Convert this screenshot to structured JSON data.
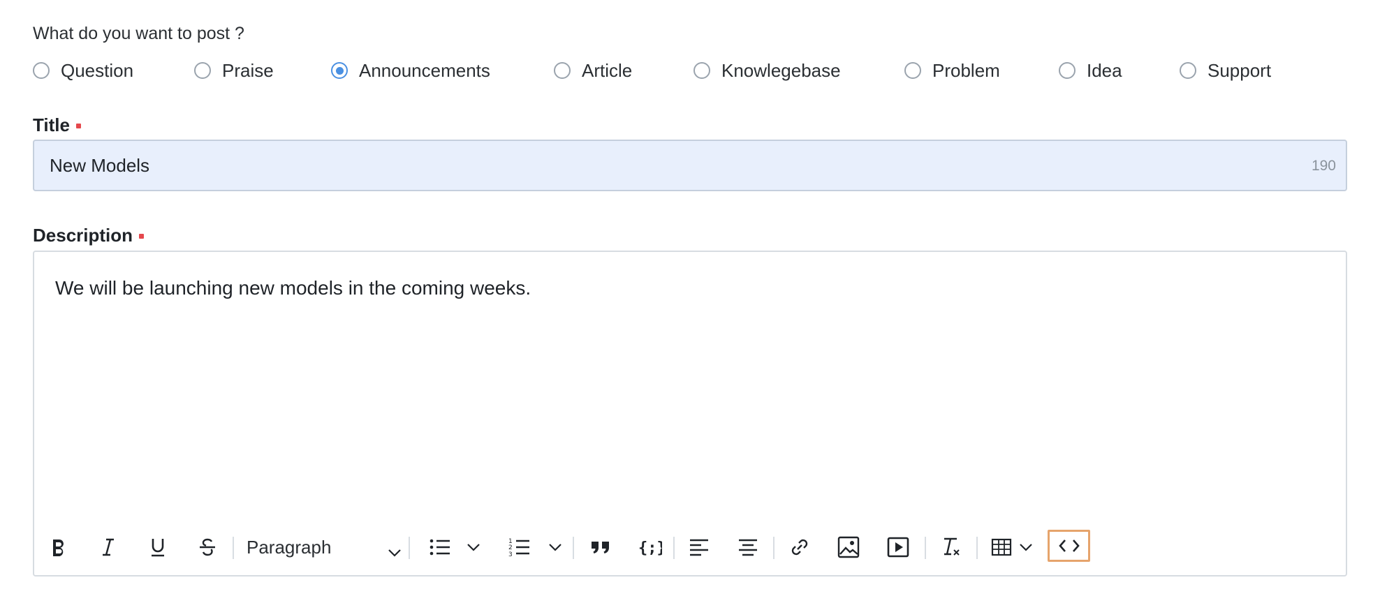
{
  "question": "What do you want to post ?",
  "post_types": [
    {
      "label": "Question",
      "checked": false
    },
    {
      "label": "Praise",
      "checked": false
    },
    {
      "label": "Announcements",
      "checked": true
    },
    {
      "label": "Article",
      "checked": false
    },
    {
      "label": "Knowlegebase",
      "checked": false
    },
    {
      "label": "Problem",
      "checked": false
    },
    {
      "label": "Idea",
      "checked": false
    },
    {
      "label": "Support",
      "checked": false
    }
  ],
  "title_field": {
    "label": "Title",
    "value": "New Models",
    "char_count": "190"
  },
  "description_field": {
    "label": "Description",
    "text": "We will be launching new models in the coming weeks."
  },
  "toolbar": {
    "format_value": "Paragraph",
    "buttons": [
      "bold-icon",
      "italic-icon",
      "underline-icon",
      "strikethrough-icon",
      "bullet-list-icon",
      "numbered-list-icon",
      "blockquote-icon",
      "code-block-icon",
      "align-left-icon",
      "align-center-icon",
      "link-icon",
      "image-icon",
      "video-icon",
      "clear-format-icon",
      "table-icon",
      "source-code-icon"
    ]
  },
  "colors": {
    "accent": "#4a90e2",
    "required": "#e5484d",
    "input_bg": "#e8effc",
    "highlight": "#e6a46c"
  }
}
